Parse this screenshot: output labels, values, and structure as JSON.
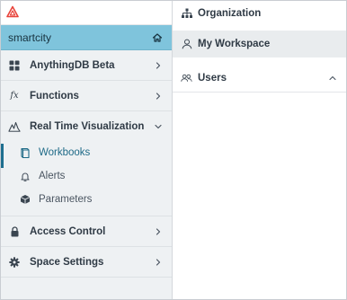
{
  "sidebar": {
    "space_name": "smartcity",
    "items": [
      {
        "label": "AnythingDB Beta"
      },
      {
        "label": "Functions"
      },
      {
        "label": "Real Time Visualization"
      },
      {
        "label": "Access Control"
      },
      {
        "label": "Space Settings"
      }
    ],
    "sub_items": [
      {
        "label": "Workbooks"
      },
      {
        "label": "Alerts"
      },
      {
        "label": "Parameters"
      }
    ]
  },
  "panel": {
    "items": [
      {
        "label": "Organization"
      },
      {
        "label": "My Workspace"
      },
      {
        "label": "Users"
      }
    ]
  },
  "colors": {
    "space_bar": "#7fc4dc",
    "logo": "#e8433a",
    "active_text": "#1e6a87",
    "sidebar_bg": "#eef1f3",
    "selected_bg": "#e9ecee"
  },
  "icons": {
    "logo": "triangle-logo-icon",
    "home": "home-icon",
    "anythingdb": "grid-icon",
    "functions": "fx-icon",
    "realtime": "chart-peaks-icon",
    "workbooks": "book-icon",
    "alerts": "bell-icon",
    "parameters": "cube-icon",
    "access_control": "lock-icon",
    "space_settings": "gear-icon",
    "organization": "org-tree-icon",
    "workspace": "person-icon",
    "users": "users-icon"
  }
}
